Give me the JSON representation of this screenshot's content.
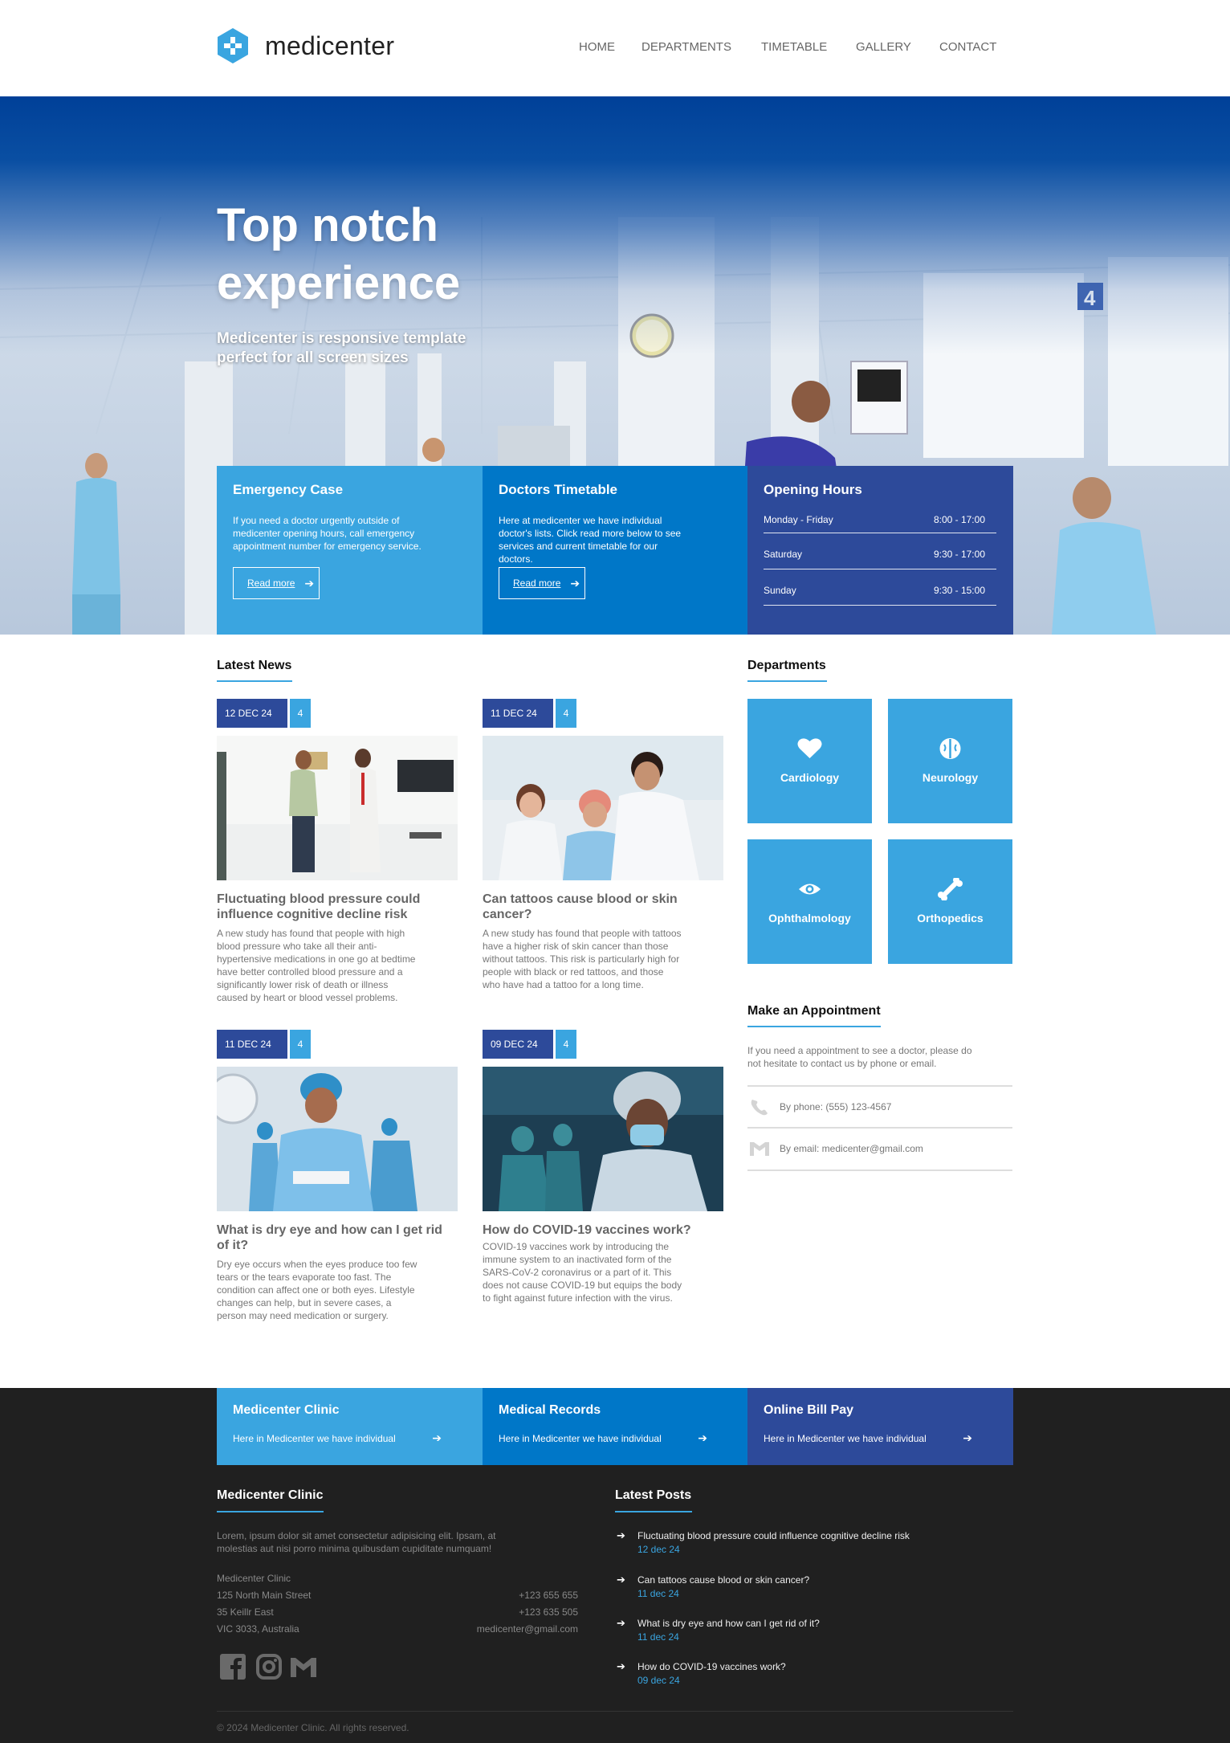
{
  "brand": {
    "name": "medicenter",
    "accent": "#3aa5e0",
    "navy": "#2d4a9a",
    "blue": "#0077c8"
  },
  "nav": {
    "items": [
      "HOME",
      "DEPARTMENTS",
      "TIMETABLE",
      "GALLERY",
      "CONTACT"
    ]
  },
  "hero": {
    "title_line1": "Top notch",
    "title_line2": "experience",
    "subtitle_line1": "Medicenter is responsive template",
    "subtitle_line2": "perfect for all screen sizes"
  },
  "info": {
    "emergency": {
      "title": "Emergency Case",
      "text": "If you need a doctor urgently outside of medicenter opening hours, call emergency appointment number for emergency service.",
      "button": "Read more"
    },
    "timetable": {
      "title": "Doctors Timetable",
      "text": "Here at medicenter we have individual doctor's lists. Click read more below to see services and current timetable for our doctors.",
      "button": "Read more"
    },
    "hours": {
      "title": "Opening Hours",
      "rows": [
        {
          "day": "Monday - Friday",
          "time": "8:00 - 17:00"
        },
        {
          "day": "Saturday",
          "time": "9:30 - 17:00"
        },
        {
          "day": "Sunday",
          "time": "9:30 - 15:00"
        }
      ]
    }
  },
  "news": {
    "title": "Latest News",
    "items": [
      {
        "date": "12 DEC 24",
        "count": "4",
        "title": "Fluctuating blood pressure could influence cognitive decline risk",
        "text": "A new study has found that people with high blood pressure who take all their anti-hypertensive medications in one go at bedtime have better controlled blood pressure and a significantly lower risk of death or illness caused by heart or blood vessel problems."
      },
      {
        "date": "11 DEC 24",
        "count": "4",
        "title": "Can tattoos cause blood or skin cancer?",
        "text": "A new study has found that people with tattoos have a higher risk of skin cancer than those without tattoos. This risk is particularly high for people with black or red tattoos, and those who have had a tattoo for a long time."
      },
      {
        "date": "11 DEC 24",
        "count": "4",
        "title": "What is dry eye and how can I get rid of it?",
        "text": "Dry eye occurs when the eyes produce too few tears or the tears evaporate too fast. The condition can affect one or both eyes. Lifestyle changes can help, but in severe cases, a person may need medication or surgery."
      },
      {
        "date": "09 DEC 24",
        "count": "4",
        "title": "How do COVID-19 vaccines work?",
        "text": "COVID-19 vaccines work by introducing the immune system to an inactivated form of the SARS-CoV-2 coronavirus or a part of it. This does not cause COVID-19 but equips the body to fight against future infection with the virus."
      }
    ]
  },
  "departments": {
    "title": "Departments",
    "items": [
      {
        "label": "Cardiology",
        "icon": "heart-icon"
      },
      {
        "label": "Neurology",
        "icon": "brain-icon"
      },
      {
        "label": "Ophthalmology",
        "icon": "eye-icon"
      },
      {
        "label": "Orthopedics",
        "icon": "bone-icon"
      }
    ]
  },
  "appointment": {
    "title": "Make an Appointment",
    "text": "If you need a appointment to see a doctor, please do not hesitate to contact us by phone or email.",
    "phone": "By phone: (555) 123-4567",
    "email": "By email: medicenter@gmail.com"
  },
  "footer_boxes": [
    {
      "title": "Medicenter Clinic",
      "text": "Here in Medicenter we have individual"
    },
    {
      "title": "Medical Records",
      "text": "Here in Medicenter we have individual"
    },
    {
      "title": "Online Bill Pay",
      "text": "Here in Medicenter we have individual"
    }
  ],
  "footer": {
    "clinic_title": "Medicenter Clinic",
    "clinic_text": "Lorem, ipsum dolor sit amet consectetur adipisicing elit. Ipsam, at molestias aut nisi porro minima quibusdam cupiditate numquam!",
    "address": [
      "Medicenter Clinic",
      "125 North Main Street",
      "35 Keillr East",
      "VIC 3033, Australia"
    ],
    "phones": [
      "+123 655 655",
      "+123 635 505",
      "medicenter@gmail.com"
    ],
    "posts_title": "Latest Posts",
    "posts": [
      {
        "title": "Fluctuating blood pressure could influence cognitive decline risk",
        "date": "12 dec 24"
      },
      {
        "title": "Can tattoos cause blood or skin cancer?",
        "date": "11 dec 24"
      },
      {
        "title": "What is dry eye and how can I get rid of it?",
        "date": "11 dec 24"
      },
      {
        "title": "How do COVID-19 vaccines work?",
        "date": "09 dec 24"
      }
    ],
    "copyright": "© 2024 Medicenter Clinic. All rights reserved."
  }
}
